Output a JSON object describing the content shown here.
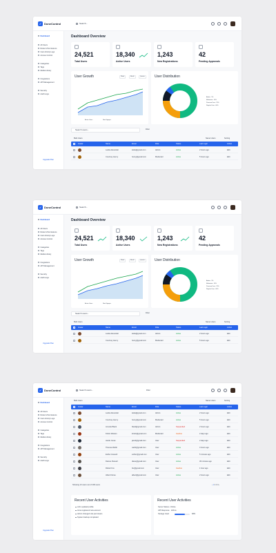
{
  "brand": "DoneControl",
  "search_placeholder": "Search...",
  "sidebar": {
    "items": [
      {
        "label": "Dashboard",
        "active": true
      },
      {
        "label": "All Users"
      },
      {
        "label": "Roles & Permissions"
      },
      {
        "label": "User Activity Logs"
      },
      {
        "label": "Access Control"
      },
      {
        "label": "Categories"
      },
      {
        "label": "Tags"
      },
      {
        "label": "Media Library"
      },
      {
        "label": "Integrations"
      },
      {
        "label": "API Management"
      },
      {
        "label": "Security"
      },
      {
        "label": "Audit Logs"
      }
    ],
    "upgrade": "Upgrade Plan"
  },
  "page_title": "Dashboard Overview",
  "stats": [
    {
      "value": "24,521",
      "label": "Total Users"
    },
    {
      "value": "18,340",
      "label": "Active Users"
    },
    {
      "value": "1,243",
      "label": "New Registrations"
    },
    {
      "value": "42",
      "label": "Pending Approvals"
    }
  ],
  "growth": {
    "title": "User Growth",
    "chips": [
      "Week",
      "Month",
      "Quarter"
    ],
    "legend": [
      "Active Users",
      "New Signups"
    ]
  },
  "distribution": {
    "title": "User Distribution",
    "legend": [
      "Admin - 5%",
      "Moderator - 10%",
      "Premium User - 25%",
      "Regular User - 60%"
    ]
  },
  "toolbar": {
    "search": "Search users...",
    "filter": "Filter",
    "bulk": "Bulk Users",
    "sort_name": "Name Users",
    "sorting": "Sorting"
  },
  "table": {
    "headers": [
      "Avatar",
      "Name",
      "Email",
      "Role",
      "Status",
      "Last Login",
      "Action"
    ],
    "rows": [
      {
        "name": "Leslie Alexander",
        "email": "leslie@gmail.com",
        "role": "Admin",
        "status": "Active",
        "login": "2 hours ago",
        "action": "Edit"
      },
      {
        "name": "Courtney Henry",
        "email": "henry@gmail.com",
        "role": "Moderator",
        "status": "Active",
        "login": "5 hours ago",
        "action": "Edit"
      },
      {
        "name": "Annette Black",
        "email": "black@gmail.com",
        "role": "Admin",
        "status": "Suspended",
        "login": "2 hours ago",
        "action": "Edit"
      },
      {
        "name": "Kristin Watson",
        "email": "kristin@gmail.com",
        "role": "Moderator",
        "status": "Inactive",
        "login": "2 days ago",
        "action": "Edit"
      },
      {
        "name": "Jacob Jones",
        "email": "jacob@gmail.com",
        "role": "User",
        "status": "Suspended",
        "login": "2 days ago",
        "action": "Edit"
      },
      {
        "name": "Theresa Webb",
        "email": "webb@gmail.com",
        "role": "User",
        "status": "Active",
        "login": "4 hours ago",
        "action": "Edit"
      },
      {
        "name": "Esther Howard",
        "email": "esther@gmail.com",
        "role": "User",
        "status": "Active",
        "login": "5 minutes ago",
        "action": "Edit"
      },
      {
        "name": "Dianne Russell",
        "email": "diane@gmail.com",
        "role": "User",
        "status": "Active",
        "login": "30 minutes ago",
        "action": "Edit"
      },
      {
        "name": "Robert Fox",
        "email": "fox@gmail.com",
        "role": "User",
        "status": "Inactive",
        "login": "1 hour ago",
        "action": "Edit"
      },
      {
        "name": "Albert Flores",
        "email": "albert@gmail.com",
        "role": "User",
        "status": "Active",
        "login": "2 hours ago",
        "action": "Edit"
      }
    ],
    "footer": "Showing 10 users out of 200 users",
    "pages": [
      "1",
      "2",
      "3",
      "4"
    ]
  },
  "activities": {
    "title": "Recent User Activities",
    "items": [
      "John updated profile",
      "Anna registered new account",
      "Admin changed role permission",
      "System backup completed"
    ]
  },
  "system": {
    "title": "Recent User Activities",
    "rows": [
      {
        "label": "Server Status",
        "value": "Online"
      },
      {
        "label": "API Response",
        "value": "120ms"
      },
      {
        "label": "Storage Used",
        "value": "68%"
      }
    ],
    "storage_fraction": 0.68
  },
  "colors": {
    "accent": "#2563eb",
    "green": "#16a34a",
    "orange": "#f59e0b",
    "teal": "#10b981"
  }
}
